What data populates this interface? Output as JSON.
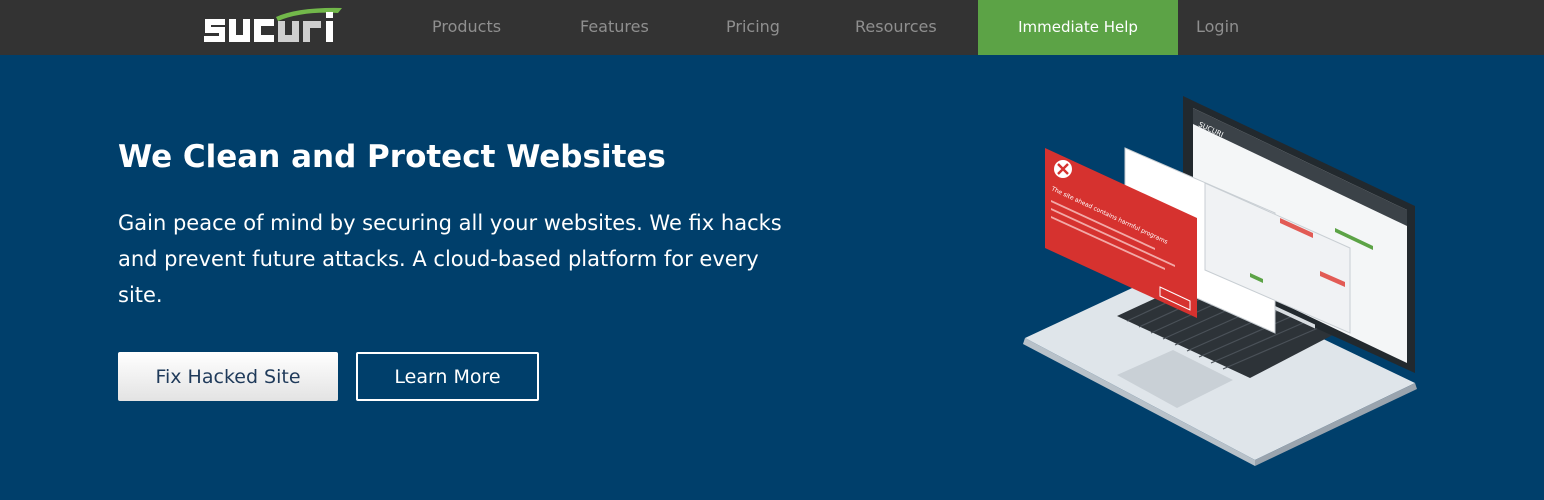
{
  "nav": {
    "logo_text": "sucuri",
    "items": [
      {
        "label": "Products"
      },
      {
        "label": "Features"
      },
      {
        "label": "Pricing"
      },
      {
        "label": "Resources"
      }
    ],
    "help_label": "Immediate Help",
    "login_label": "Login"
  },
  "hero": {
    "title": "We Clean and Protect Websites",
    "description": "Gain peace of mind by securing all your websites. We fix hacks and prevent future attacks. A cloud-based platform for every site.",
    "primary_button": "Fix Hacked Site",
    "secondary_button": "Learn More"
  },
  "illustration": {
    "alert_title": "The site ahead contains harmful programs",
    "screen_brand": "SUCURI"
  },
  "colors": {
    "nav_bg": "#333333",
    "hero_bg": "#003f6b",
    "accent_green": "#5ca346",
    "alert_red": "#d6322f"
  }
}
